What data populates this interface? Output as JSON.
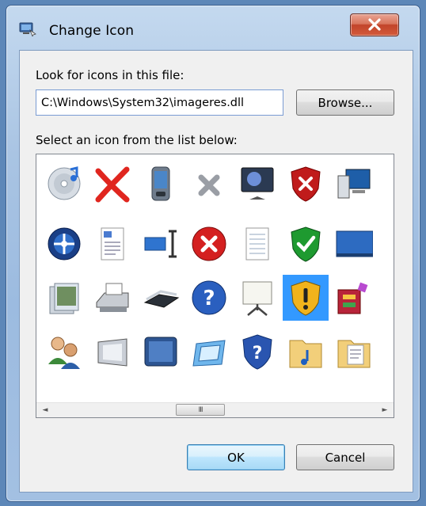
{
  "window": {
    "title": "Change Icon"
  },
  "form": {
    "path_label": "Look for icons in this file:",
    "path_value": "C:\\Windows\\System32\\imageres.dll",
    "browse_label": "Browse...",
    "list_label": "Select an icon from the list below:"
  },
  "icons": [
    {
      "name": "cd-music-icon"
    },
    {
      "name": "red-x-icon"
    },
    {
      "name": "pda-device-icon"
    },
    {
      "name": "gray-x-icon"
    },
    {
      "name": "monitor-icon"
    },
    {
      "name": "shield-error-icon"
    },
    {
      "name": "network-computer-icon"
    },
    {
      "name": "folder-partial-icon"
    },
    {
      "name": "disk-utility-icon"
    },
    {
      "name": "document-icon"
    },
    {
      "name": "text-cursor-icon"
    },
    {
      "name": "error-circle-icon"
    },
    {
      "name": "notepad-icon"
    },
    {
      "name": "shield-check-icon"
    },
    {
      "name": "desktop-icon"
    },
    {
      "name": "gear-partial-icon"
    },
    {
      "name": "images-folder-icon"
    },
    {
      "name": "printer-icon"
    },
    {
      "name": "scanner-icon"
    },
    {
      "name": "help-circle-icon"
    },
    {
      "name": "projector-screen-icon"
    },
    {
      "name": "shield-warning-icon"
    },
    {
      "name": "programs-icon"
    },
    {
      "name": "folder-partial-icon-2"
    },
    {
      "name": "users-icon"
    },
    {
      "name": "display-panel-icon"
    },
    {
      "name": "tablet-icon"
    },
    {
      "name": "frame-icon"
    },
    {
      "name": "shield-help-icon"
    },
    {
      "name": "music-folder-icon"
    },
    {
      "name": "documents-folder-icon"
    },
    {
      "name": "green-list-icon"
    }
  ],
  "selected_icon_index": 21,
  "scrollbar": {
    "left_arrow": "◄",
    "thumb_grip": "III",
    "right_arrow": "►"
  },
  "buttons": {
    "ok": "OK",
    "cancel": "Cancel"
  },
  "colors": {
    "selection": "#3399ff",
    "frame": "#a9c4e3",
    "close_button": "#c2442a"
  }
}
